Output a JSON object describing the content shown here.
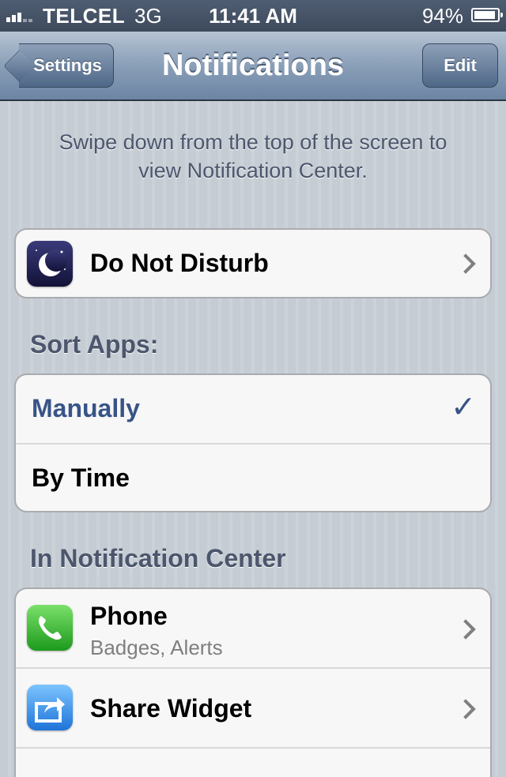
{
  "status_bar": {
    "carrier": "TELCEL",
    "network": "3G",
    "time": "11:41 AM",
    "battery_percent": "94%"
  },
  "nav_bar": {
    "back_label": "Settings",
    "title": "Notifications",
    "edit_label": "Edit"
  },
  "hint": {
    "line1": "Swipe down from the top of the screen to",
    "line2": "view Notification Center."
  },
  "do_not_disturb": {
    "label": "Do Not Disturb",
    "icon": "moon-icon"
  },
  "sort_apps": {
    "header": "Sort Apps:",
    "options": [
      {
        "label": "Manually",
        "selected": true
      },
      {
        "label": "By Time",
        "selected": false
      }
    ]
  },
  "notification_center": {
    "header": "In Notification Center",
    "apps": [
      {
        "name": "Phone",
        "detail": "Badges, Alerts",
        "icon": "phone-icon"
      },
      {
        "name": "Share Widget",
        "icon": "share-icon"
      }
    ]
  },
  "colors": {
    "accent": "#385487",
    "section_text": "#4c566c",
    "phone_icon": "#3bb133",
    "share_icon": "#2a8ee6",
    "dnd_icon": "#1a1a4a"
  }
}
